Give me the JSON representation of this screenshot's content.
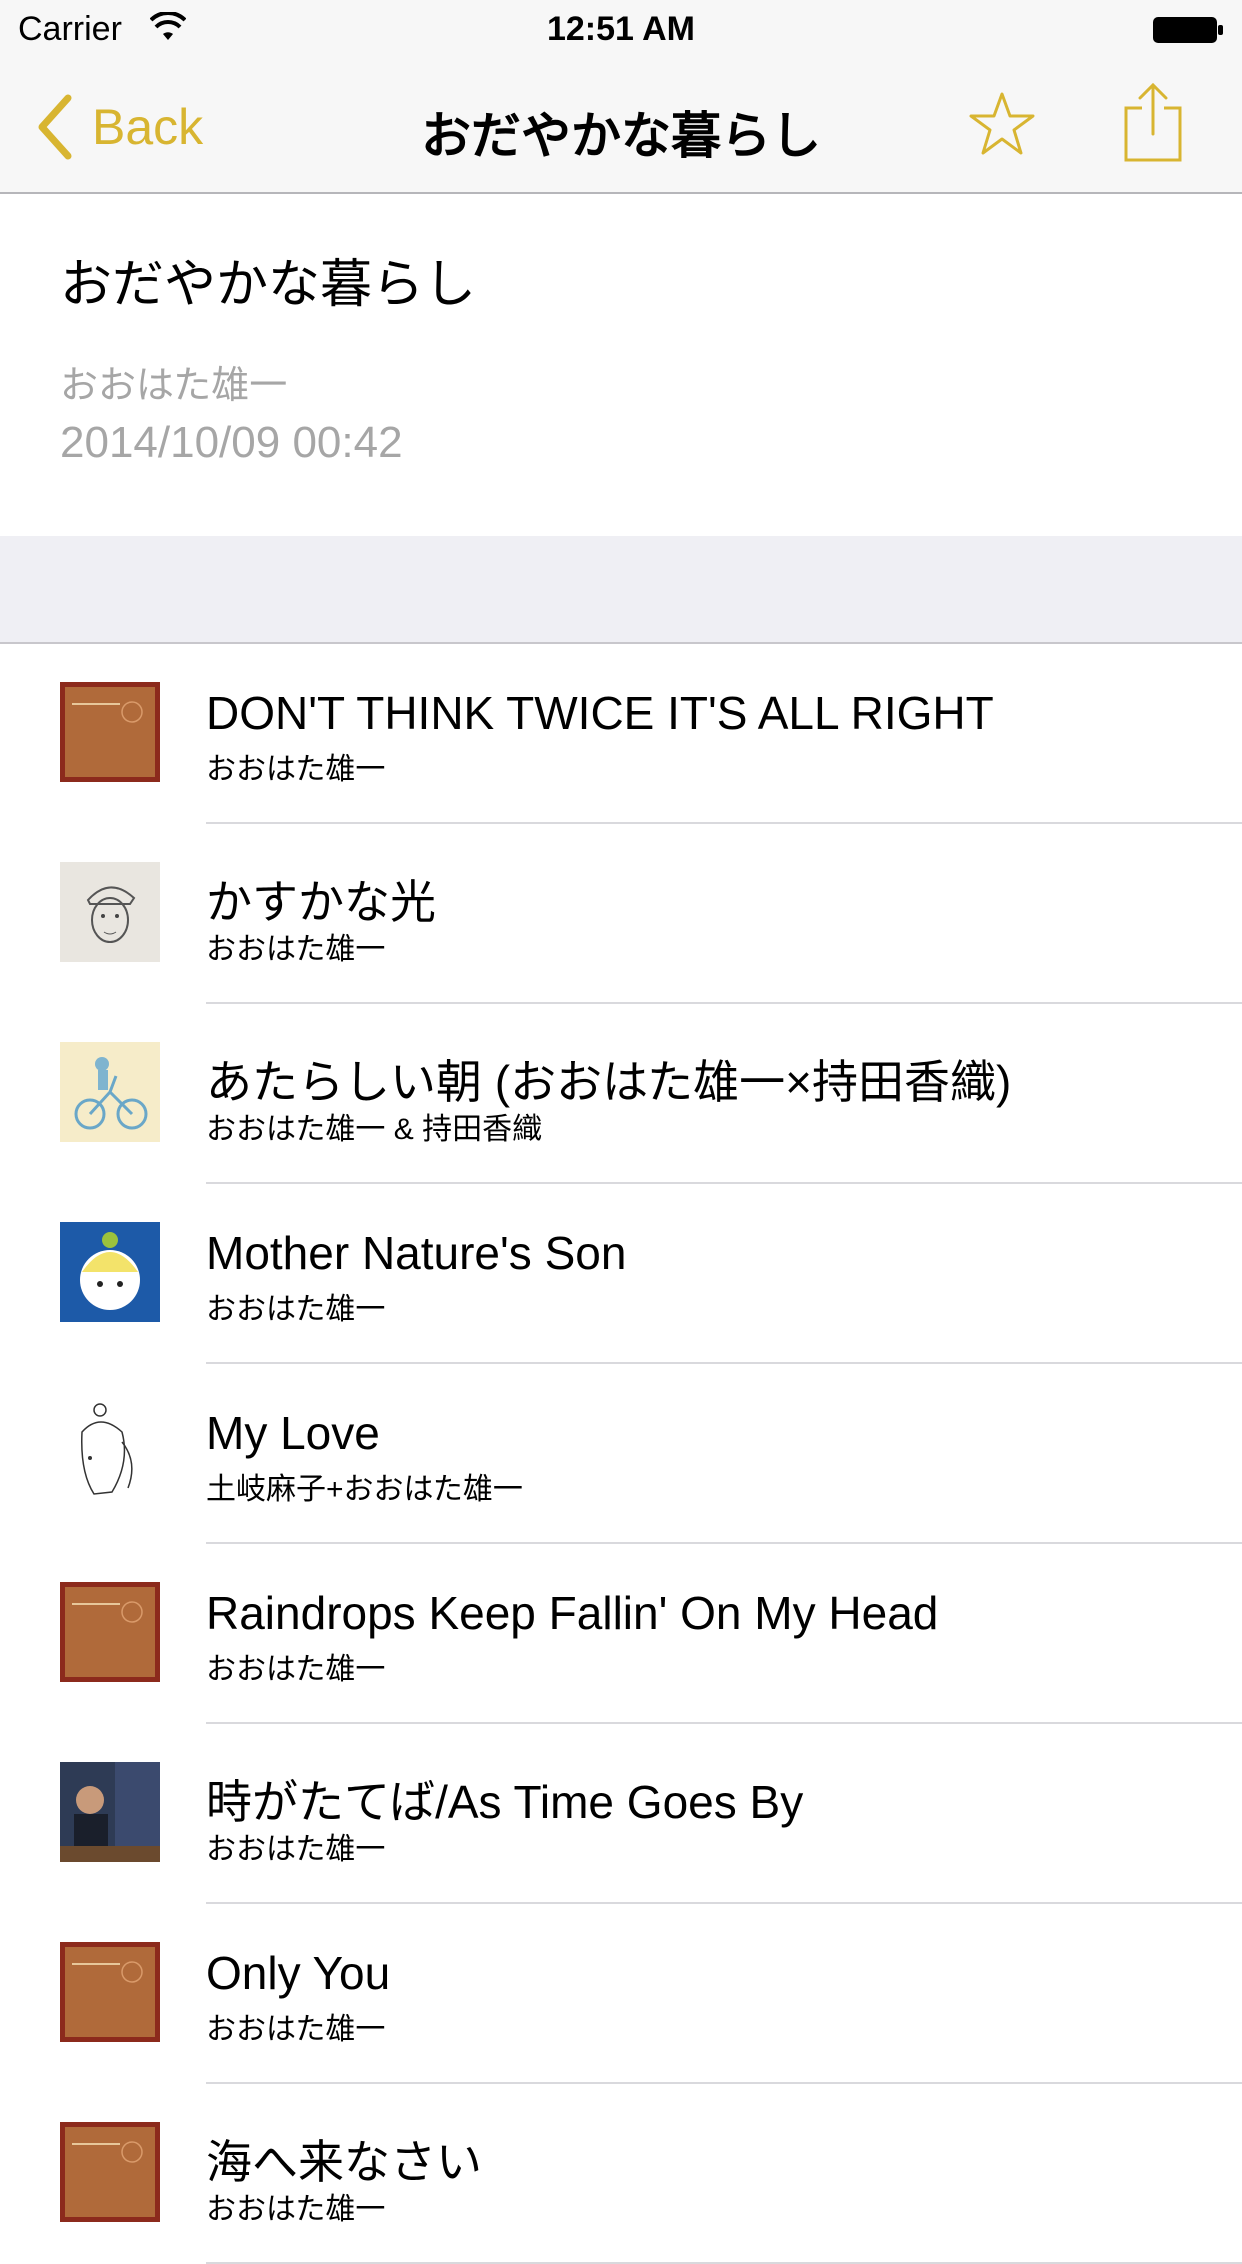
{
  "status": {
    "carrier": "Carrier",
    "time": "12:51 AM"
  },
  "nav": {
    "back_label": "Back",
    "title": "おだやかな暮らし"
  },
  "playlist": {
    "title": "おだやかな暮らし",
    "author": "おおはた雄一",
    "date": "2014/10/09 00:42"
  },
  "colors": {
    "accent": "#d8b531",
    "muted": "#a6a6a6",
    "group_bg": "#efeff4"
  },
  "songs": [
    {
      "title": "DON'T THINK TWICE IT'S ALL RIGHT",
      "artist": "おおはた雄一",
      "art": "brown-cover"
    },
    {
      "title": "かすかな光",
      "artist": "おおはた雄一",
      "art": "sketch-portrait"
    },
    {
      "title": "あたらしい朝 (おおはた雄一×持田香織)",
      "artist": "おおはた雄一 & 持田香織",
      "art": "bicycle-illustration"
    },
    {
      "title": "Mother Nature's Son",
      "artist": "おおはた雄一",
      "art": "apple-head-character"
    },
    {
      "title": "My Love",
      "artist": "土岐麻子+おおはた雄一",
      "art": "line-drawing"
    },
    {
      "title": "Raindrops Keep Fallin' On My Head",
      "artist": "おおはた雄一",
      "art": "brown-cover"
    },
    {
      "title": "時がたてば/As Time Goes By",
      "artist": "おおはた雄一",
      "art": "music-shop-photo"
    },
    {
      "title": "Only You",
      "artist": "おおはた雄一",
      "art": "brown-cover"
    },
    {
      "title": "海へ来なさい",
      "artist": "おおはた雄一",
      "art": "brown-cover"
    }
  ]
}
